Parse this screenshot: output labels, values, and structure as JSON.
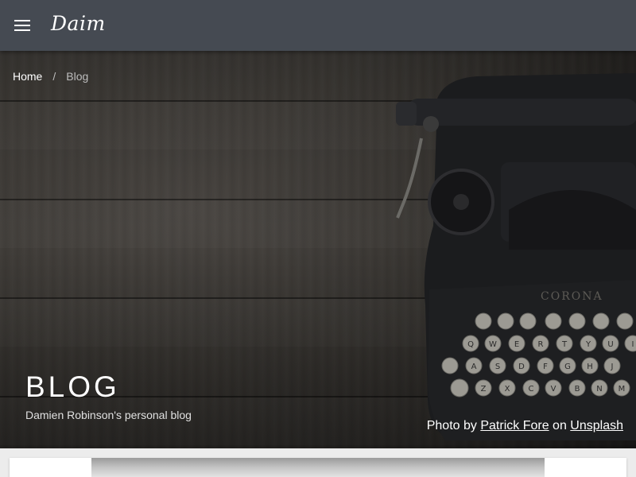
{
  "appbar": {
    "menu_icon": "menu-icon",
    "brand": "Daim",
    "background": "#454a52"
  },
  "breadcrumb": {
    "home": "Home",
    "separator": "/",
    "current": "Blog"
  },
  "hero": {
    "title": "BLOG",
    "subtitle": "Damien Robinson's personal blog",
    "image_subject": "typewriter",
    "credit": {
      "prefix": "Photo by",
      "author": "Patrick Fore",
      "middle": "on",
      "source": "Unsplash"
    }
  },
  "colors": {
    "appbar": "#454a52",
    "hero_text": "#ffffff",
    "breadcrumb_current": "#bdbdbd",
    "page_background": "#ececec"
  }
}
